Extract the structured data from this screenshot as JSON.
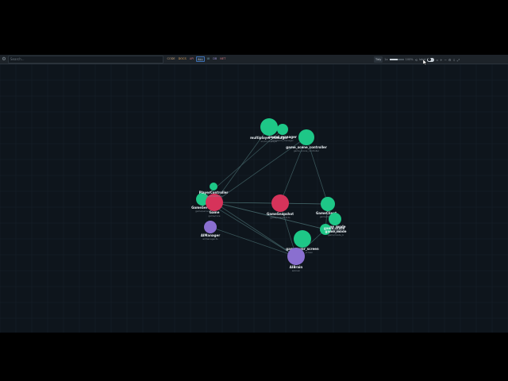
{
  "toolbar": {
    "search_placeholder": "Search...",
    "filters": [
      {
        "label": "CODE",
        "active": false
      },
      {
        "label": "DOCS",
        "active": false
      },
      {
        "label": "API",
        "active": false
      },
      {
        "label": "ALL",
        "active": true
      },
      {
        "label": "UI",
        "active": false
      },
      {
        "label": "DB",
        "active": false
      },
      {
        "label": "NET",
        "active": false
      }
    ],
    "layout_label": "Tidy",
    "zoom_label": "1x",
    "spacing_label": "100%",
    "labels_label": "label",
    "slider_value": 0.6
  },
  "colors": {
    "green": "#1ec787",
    "red": "#d6335a",
    "purple": "#8a6fd0",
    "edge": "#3f5f63",
    "label": "#e8eef2",
    "sublabel": "#7f8a93",
    "background": "#0e151c",
    "grid": "#17212a"
  },
  "nodes": [
    {
      "id": "multiplayer_manager",
      "label": "multiplayer_manager",
      "sub": "src/multiplayer",
      "color": "green"
    },
    {
      "id": "sound_manager",
      "label": "sound_manager",
      "sub": "src/sound_manager",
      "color": "green"
    },
    {
      "id": "game_scene_controller",
      "label": "game_scene_controller",
      "sub": "game_scene_controller",
      "color": "green"
    },
    {
      "id": "GameSnapshot",
      "label": "GameSnapshot",
      "sub": "game/snapshot.ts",
      "color": "red"
    },
    {
      "id": "GameClient",
      "label": "GameClient",
      "sub": "game/client",
      "color": "green"
    },
    {
      "id": "game_mode",
      "label": "game_mode",
      "sub": "game/mode",
      "color": "green"
    },
    {
      "id": "game_over_screen",
      "label": "game_over_screen",
      "sub": "game_over_screen",
      "color": "green"
    },
    {
      "id": "AIBrain",
      "label": "AIBrain",
      "sub": "ai/brain",
      "color": "purple"
    },
    {
      "id": "AIManager",
      "label": "AIManager",
      "sub": "ai/manager.ts",
      "color": "purple"
    },
    {
      "id": "GameServer",
      "label": "GameServer",
      "sub": "game/server",
      "color": "green"
    },
    {
      "id": "Game",
      "label": "Game",
      "sub": "game/core",
      "color": "red"
    },
    {
      "id": "PlayerController",
      "label": "PlayerController",
      "sub": "player/controller",
      "color": "green"
    },
    {
      "id": "game_state",
      "label": "game_state",
      "sub": "game/state",
      "color": "green"
    },
    {
      "id": "game_mode_b",
      "label": "game_mode",
      "sub": "game/mode_b",
      "color": "green"
    }
  ],
  "edges": [
    [
      "game_scene_controller",
      "Game"
    ],
    [
      "game_scene_controller",
      "GameSnapshot"
    ],
    [
      "game_scene_controller",
      "GameClient"
    ],
    [
      "multiplayer_manager",
      "Game"
    ],
    [
      "sound_manager",
      "GameServer"
    ],
    [
      "Game",
      "GameSnapshot"
    ],
    [
      "Game",
      "GameClient"
    ],
    [
      "Game",
      "AIBrain"
    ],
    [
      "Game",
      "game_state"
    ],
    [
      "GameServer",
      "AIBrain"
    ],
    [
      "GameServer",
      "game_state"
    ],
    [
      "AIManager",
      "AIBrain"
    ],
    [
      "GameSnapshot",
      "AIBrain"
    ],
    [
      "GameSnapshot",
      "GameClient"
    ],
    [
      "GameClient",
      "game_mode_b"
    ],
    [
      "game_state",
      "AIBrain"
    ]
  ]
}
